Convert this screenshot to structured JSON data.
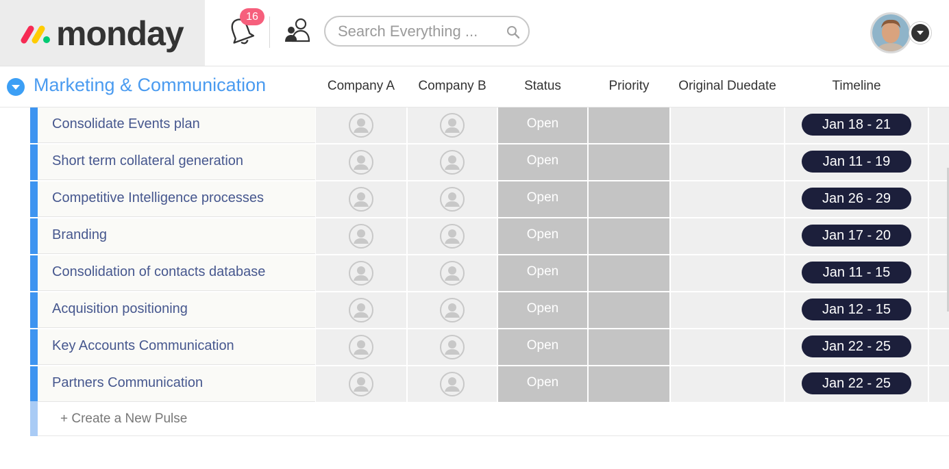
{
  "app": {
    "logo_text": "monday"
  },
  "header": {
    "notifications_count": "16",
    "search_placeholder": "Search Everything ..."
  },
  "group": {
    "title": "Marketing & Communication",
    "columns": [
      "Company A",
      "Company B",
      "Status",
      "Priority",
      "Original Duedate",
      "Timeline"
    ]
  },
  "rows": [
    {
      "name": "Consolidate Events plan",
      "status": "Open",
      "timeline": "Jan 18 - 21"
    },
    {
      "name": "Short term collateral generation",
      "status": "Open",
      "timeline": "Jan 11 - 19"
    },
    {
      "name": "Competitive Intelligence processes",
      "status": "Open",
      "timeline": "Jan 26 - 29"
    },
    {
      "name": "Branding",
      "status": "Open",
      "timeline": "Jan 17 - 20"
    },
    {
      "name": "Consolidation of contacts database",
      "status": "Open",
      "timeline": "Jan 11 - 15"
    },
    {
      "name": "Acquisition positioning",
      "status": "Open",
      "timeline": "Jan 12 - 15"
    },
    {
      "name": "Key Accounts Communication",
      "status": "Open",
      "timeline": "Jan 22 - 25"
    },
    {
      "name": "Partners Communication",
      "status": "Open",
      "timeline": "Jan 22 - 25"
    }
  ],
  "new_pulse_label": "+ Create a New Pulse",
  "colors": {
    "accent": "#3d94f0",
    "status_empty": "#c4c4c4",
    "timeline_pill": "#1c1f3b",
    "badge": "#f65f7c"
  },
  "icons": {
    "bell": "bell-icon",
    "people": "people-icon",
    "search": "search-icon",
    "person": "person-placeholder-icon",
    "dropdown": "chevron-down-icon"
  }
}
